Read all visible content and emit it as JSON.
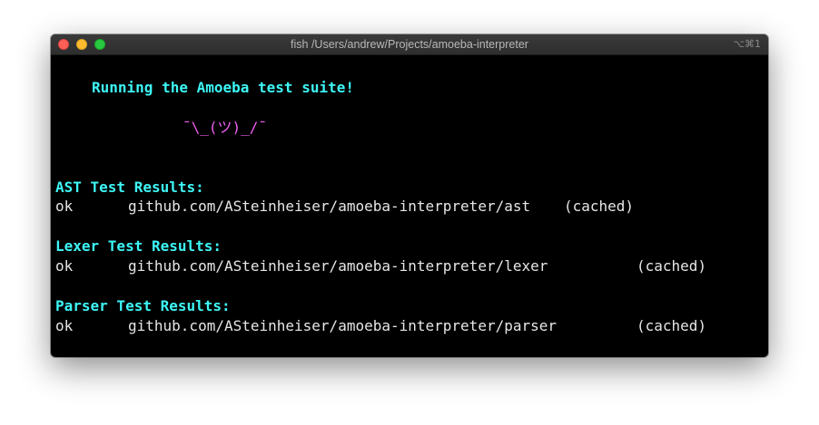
{
  "window": {
    "title": "fish /Users/andrew/Projects/amoeba-interpreter",
    "shortcut": "⌥⌘1"
  },
  "terminal": {
    "banner": "Running the Amoeba test suite!",
    "shrug": "¯\\_(ツ)_/¯",
    "sections": [
      {
        "heading": "AST Test Results:",
        "status": "ok",
        "package": "github.com/ASteinheiser/amoeba-interpreter/ast",
        "note": "(cached)"
      },
      {
        "heading": "Lexer Test Results:",
        "status": "ok",
        "package": "github.com/ASteinheiser/amoeba-interpreter/lexer",
        "note": "(cached)"
      },
      {
        "heading": "Parser Test Results:",
        "status": "ok",
        "package": "github.com/ASteinheiser/amoeba-interpreter/parser",
        "note": "(cached)"
      }
    ]
  },
  "colors": {
    "background": "#000000",
    "heading": "#3ef6f6",
    "shrug": "#f060f0",
    "text": "#e6e6e6"
  }
}
